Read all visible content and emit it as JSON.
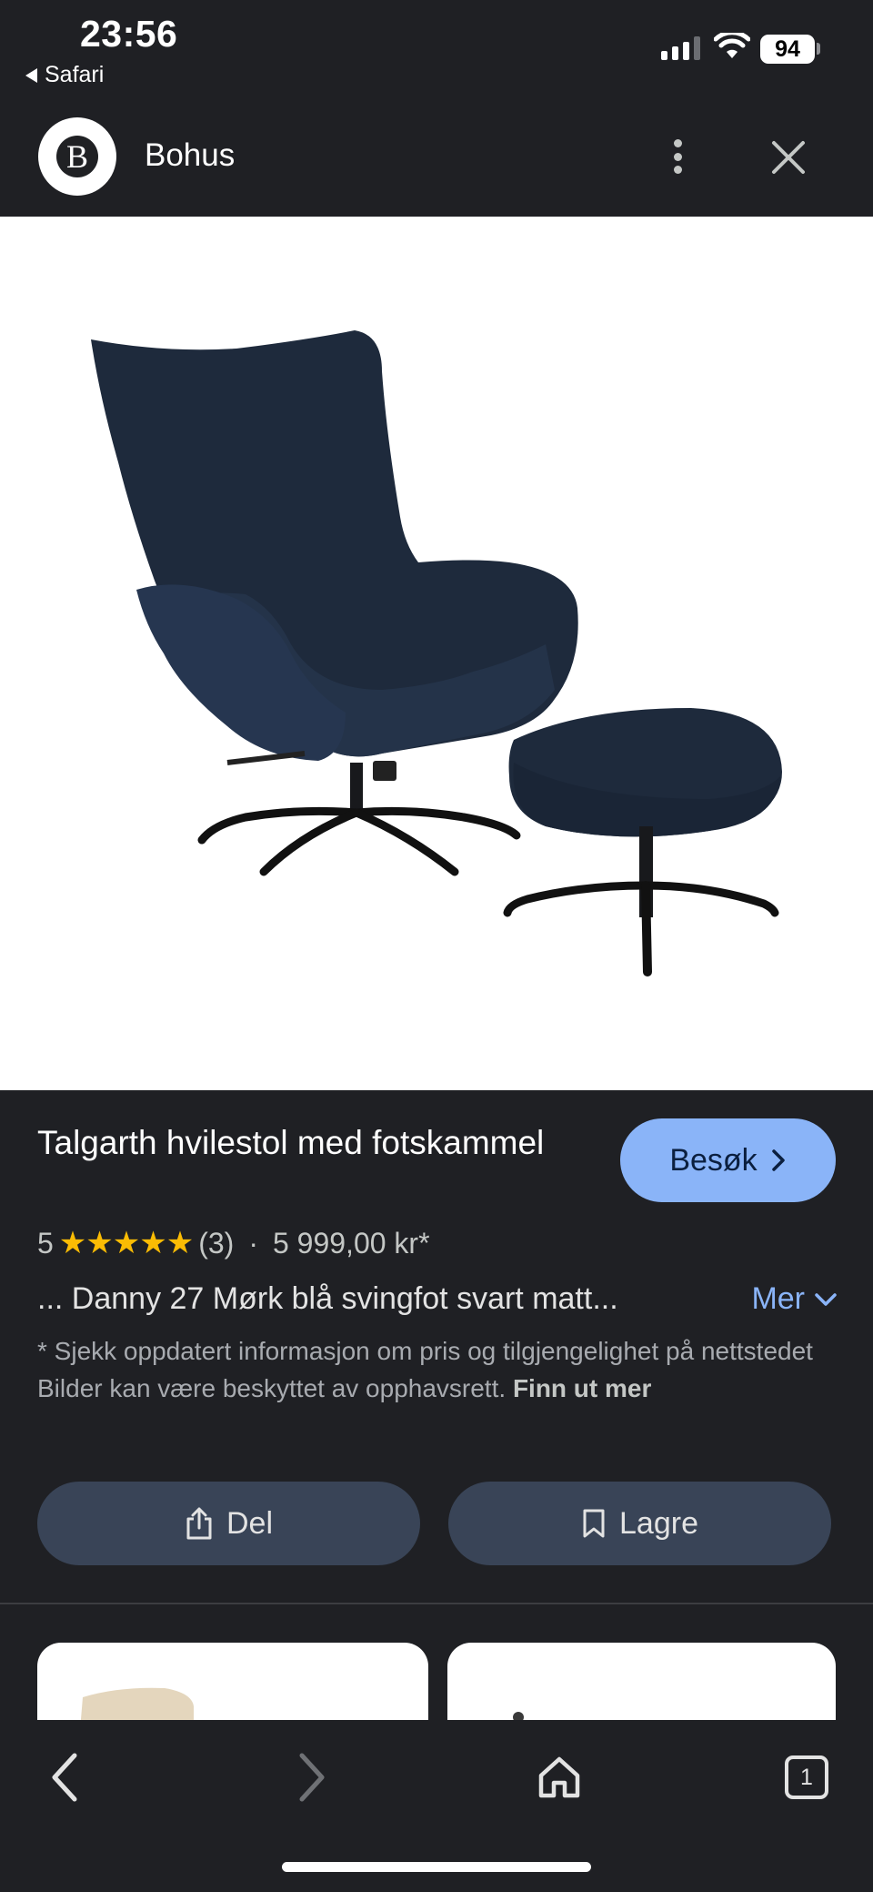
{
  "status_bar": {
    "time": "23:56",
    "back_app": "Safari",
    "battery": "94"
  },
  "header": {
    "logo_letter": "B",
    "site_name": "Bohus",
    "icons": {
      "more": "more-vert-icon",
      "close": "close-icon"
    }
  },
  "product": {
    "title": "Talgarth hvilestol med fotskammel",
    "visit_label": "Besøk",
    "rating_value": "5",
    "stars": "★★★★★",
    "rating_fraction": 1.0,
    "review_count": "(3)",
    "separator": "·",
    "price": "5 999,00 kr*",
    "description": "... Danny 27 Mørk blå svingfot svart matt...",
    "more_label": "Mer",
    "disclaimer": "* Sjekk oppdatert informasjon om pris og tilgjengelighet på nettstedet Bilder kan være beskyttet av opphavsrett.",
    "learn_more": "Finn ut mer"
  },
  "actions": {
    "share_label": "Del",
    "save_label": "Lagre"
  },
  "colors": {
    "background": "#1f2024",
    "accent": "#8ab4f8",
    "action_button": "#394457",
    "star": "#fbbc04"
  },
  "toolbar": {
    "tab_count": "1",
    "icons": {
      "back": "chevron-left-icon",
      "forward": "chevron-right-icon",
      "home": "home-icon",
      "tabs": "tabs-icon"
    }
  }
}
